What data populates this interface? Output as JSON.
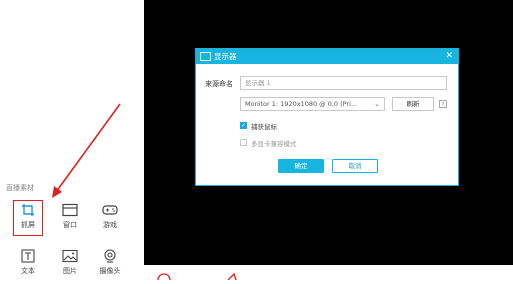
{
  "sidebar": {
    "section_label": "直播素材",
    "sources_row1": [
      {
        "label": "抓屏",
        "icon": "crop-icon"
      },
      {
        "label": "窗口",
        "icon": "window-icon"
      },
      {
        "label": "游戏",
        "icon": "gamepad-icon"
      }
    ],
    "sources_row2": [
      {
        "label": "文本",
        "icon": "text-icon"
      },
      {
        "label": "图片",
        "icon": "image-icon"
      },
      {
        "label": "摄像头",
        "icon": "camera-icon"
      }
    ]
  },
  "dialog": {
    "title": "显示器",
    "close": "✕",
    "source_name_label": "来源命名",
    "source_name_placeholder": "显示器 1",
    "monitor_value": "Monitor 1: 1920x1080 @ 0,0 (Pri...",
    "refresh_label": "刷新",
    "help_label": "?",
    "capture_mouse_label": "捕获鼠标",
    "capture_mouse_checked": true,
    "multi_gpu_label": "多显卡兼容模式",
    "multi_gpu_checked": false,
    "ok_label": "确定",
    "cancel_label": "取消"
  },
  "colors": {
    "accent": "#18b4e0",
    "annotation": "#e02020",
    "background_dark": "#000000"
  }
}
